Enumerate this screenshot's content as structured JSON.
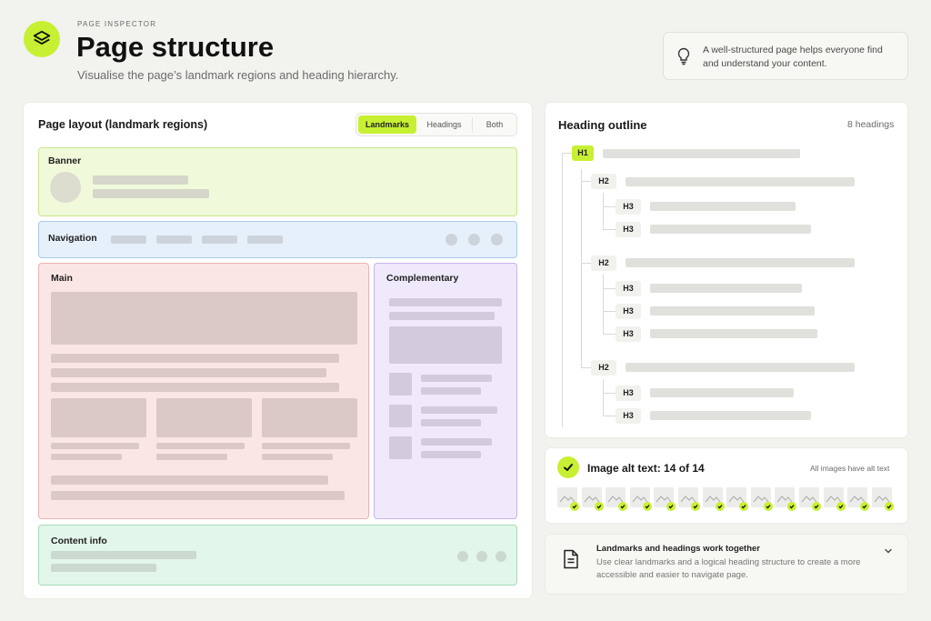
{
  "header": {
    "eyebrow": "PAGE INSPECTOR",
    "title": "Page structure",
    "subtitle": "Visualise the page’s landmark regions and heading hierarchy.",
    "logo_icon": "layers-icon",
    "tip_icon": "lightbulb-icon",
    "tip_text": "A well-structured page helps everyone find and understand your content."
  },
  "layout_panel": {
    "title": "Page layout (landmark regions)",
    "view_options": [
      "Landmarks",
      "Headings",
      "Both"
    ],
    "selected_view": "Landmarks",
    "regions": {
      "banner": "Banner",
      "navigation": "Navigation",
      "main": "Main",
      "complementary": "Complementary",
      "contentinfo": "Content info"
    }
  },
  "outline_panel": {
    "title": "Heading outline",
    "count": "8 headings",
    "headings": [
      "H1",
      "H2",
      "H3",
      "H3",
      "H2",
      "H3",
      "H3",
      "H3",
      "H2",
      "H3",
      "H3"
    ]
  },
  "alt_panel": {
    "title": "Image alt text: 14 of 14",
    "note": "All images have alt text",
    "status_icon": "check-icon",
    "thumbnail_icon": "image-icon",
    "image_count": 14
  },
  "info_panel": {
    "icon": "document-icon",
    "title": "Landmarks and headings work together",
    "body": "Use clear landmarks and a logical heading structure to create a more accessible and easier to navigate page.",
    "expand_icon": "chevron-down-icon"
  },
  "colors": {
    "accent": "#c8f032",
    "banner": "#f0f9d9",
    "navigation": "#e6f0fb",
    "main": "#fbe6e6",
    "complementary": "#efe9fb",
    "contentinfo": "#e3f6ea"
  }
}
